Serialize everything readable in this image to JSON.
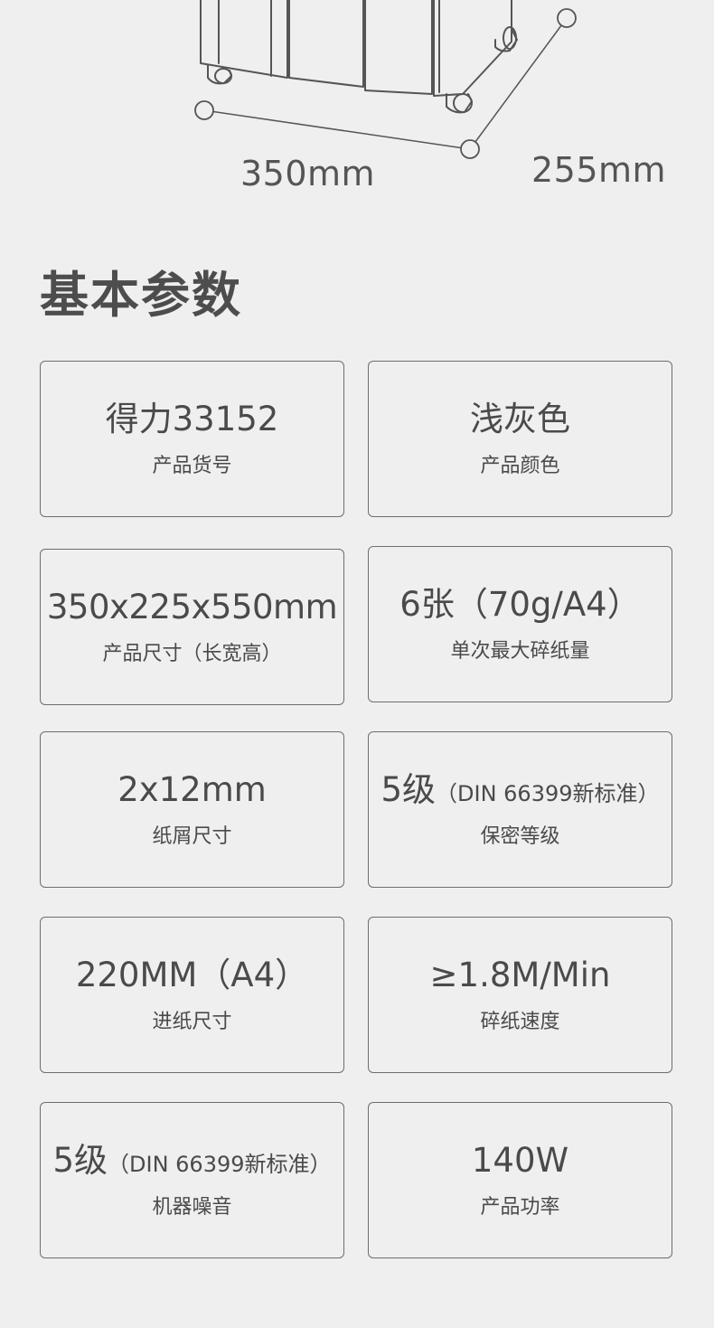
{
  "dimensions": {
    "width_label": "350mm",
    "depth_label": "255mm"
  },
  "section": {
    "title": "基本参数"
  },
  "specs": [
    {
      "value": "得力33152",
      "note": "",
      "label": "产品货号"
    },
    {
      "value": "浅灰色",
      "note": "",
      "label": "产品颜色"
    },
    {
      "value": "350x225x550mm",
      "note": "",
      "label": "产品尺寸（长宽高）"
    },
    {
      "value": "6张（70g/A4）",
      "note": "",
      "label": "单次最大碎纸量"
    },
    {
      "value": "2x12mm",
      "note": "",
      "label": "纸屑尺寸"
    },
    {
      "value": "5级",
      "note": "（DIN 66399新标准）",
      "label": "保密等级"
    },
    {
      "value": "220MM（A4）",
      "note": "",
      "label": "进纸尺寸"
    },
    {
      "value": "≥1.8M/Min",
      "note": "",
      "label": "碎纸速度"
    },
    {
      "value": "5级",
      "note": "（DIN 66399新标准）",
      "label": "机器噪音"
    },
    {
      "value": "140W",
      "note": "",
      "label": "产品功率"
    }
  ]
}
